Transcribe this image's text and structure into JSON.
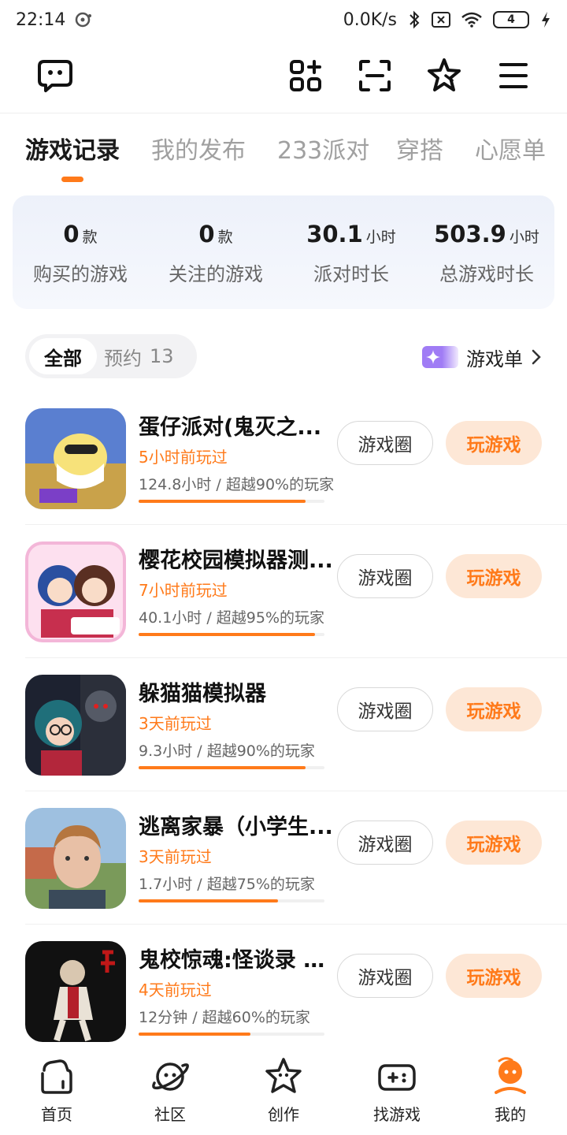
{
  "status_bar": {
    "time": "22:14",
    "net_speed": "0.0K/s",
    "battery": "4"
  },
  "tabs": [
    {
      "label": "游戏记录",
      "active": true
    },
    {
      "label": "我的发布",
      "active": false
    },
    {
      "label": "233派对",
      "active": false
    },
    {
      "label": "穿搭",
      "active": false
    },
    {
      "label": "心愿单",
      "active": false
    }
  ],
  "stats": [
    {
      "value": "0",
      "unit": "款",
      "label": "购买的游戏"
    },
    {
      "value": "0",
      "unit": "款",
      "label": "关注的游戏"
    },
    {
      "value": "30.1",
      "unit": "小时",
      "label": "派对时长"
    },
    {
      "value": "503.9",
      "unit": "小时",
      "label": "总游戏时长"
    }
  ],
  "filters": {
    "all": "全部",
    "reserve_label": "预约",
    "reserve_count": "13",
    "game_list": "游戏单"
  },
  "games": [
    {
      "title": "蛋仔派对(鬼灭之...",
      "played": "5小时前玩过",
      "stats": "124.8小时 / 超越90%的玩家",
      "progress": 0.9,
      "circle": "游戏圈",
      "play": "玩游戏"
    },
    {
      "title": "樱花校园模拟器测...",
      "played": "7小时前玩过",
      "stats": "40.1小时 / 超越95%的玩家",
      "progress": 0.95,
      "circle": "游戏圈",
      "play": "玩游戏"
    },
    {
      "title": "躲猫猫模拟器",
      "played": "3天前玩过",
      "stats": "9.3小时 / 超越90%的玩家",
      "progress": 0.9,
      "circle": "游戏圈",
      "play": "玩游戏"
    },
    {
      "title": "逃离家暴（小学生...",
      "played": "3天前玩过",
      "stats": "1.7小时 / 超越75%的玩家",
      "progress": 0.75,
      "circle": "游戏圈",
      "play": "玩游戏"
    },
    {
      "title": "鬼校惊魂:怪谈录 (...",
      "played": "4天前玩过",
      "stats": "12分钟 / 超越60%的玩家",
      "progress": 0.6,
      "circle": "游戏圈",
      "play": "玩游戏"
    }
  ],
  "bottom_nav": [
    {
      "label": "首页",
      "icon": "home-icon"
    },
    {
      "label": "社区",
      "icon": "community-icon"
    },
    {
      "label": "创作",
      "icon": "create-icon"
    },
    {
      "label": "找游戏",
      "icon": "gamepad-icon"
    },
    {
      "label": "我的",
      "icon": "profile-icon",
      "active": true
    }
  ],
  "colors": {
    "accent": "#ff7a1a",
    "play_button_bg": "#fde7d6"
  }
}
